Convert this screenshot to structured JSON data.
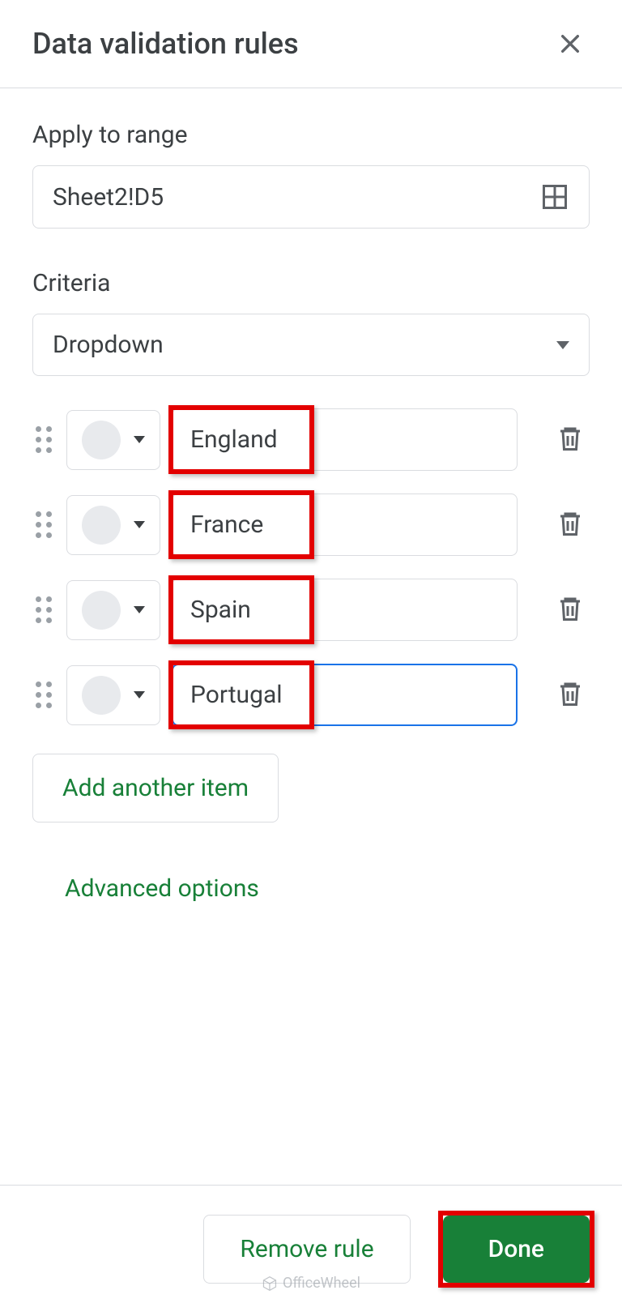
{
  "header": {
    "title": "Data validation rules"
  },
  "apply_range": {
    "label": "Apply to range",
    "value": "Sheet2!D5"
  },
  "criteria": {
    "label": "Criteria",
    "selected": "Dropdown"
  },
  "options": [
    {
      "value": "England",
      "focused": false
    },
    {
      "value": "France",
      "focused": false
    },
    {
      "value": "Spain",
      "focused": false
    },
    {
      "value": "Portugal",
      "focused": true
    }
  ],
  "buttons": {
    "add_item": "Add another item",
    "advanced": "Advanced options",
    "remove": "Remove rule",
    "done": "Done"
  },
  "watermark": "OfficeWheel"
}
